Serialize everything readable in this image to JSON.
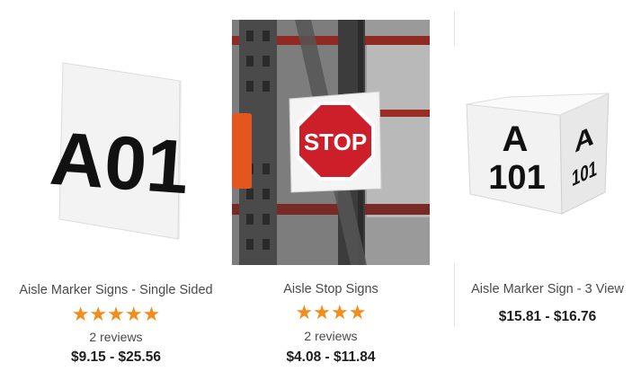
{
  "products": [
    {
      "title": "Aisle Marker Signs - Single Sided",
      "stars": "★★★★★",
      "rating": 5,
      "reviews": "2 reviews",
      "price": "$9.15 - $25.56",
      "sign_text": "A01"
    },
    {
      "title": "Aisle Stop Signs",
      "stars": "★★★★",
      "rating": 4,
      "reviews": "2 reviews",
      "price": "$4.08 - $11.84",
      "sign_text": "STOP"
    },
    {
      "title": "Aisle Marker Sign - 3 View",
      "price": "$15.81 - $16.76",
      "sign_line1": "A",
      "sign_line2": "101"
    }
  ],
  "colors": {
    "star": "#f28c1c",
    "stop_red": "#cc1f2a",
    "rack_orange": "#e3571e"
  }
}
